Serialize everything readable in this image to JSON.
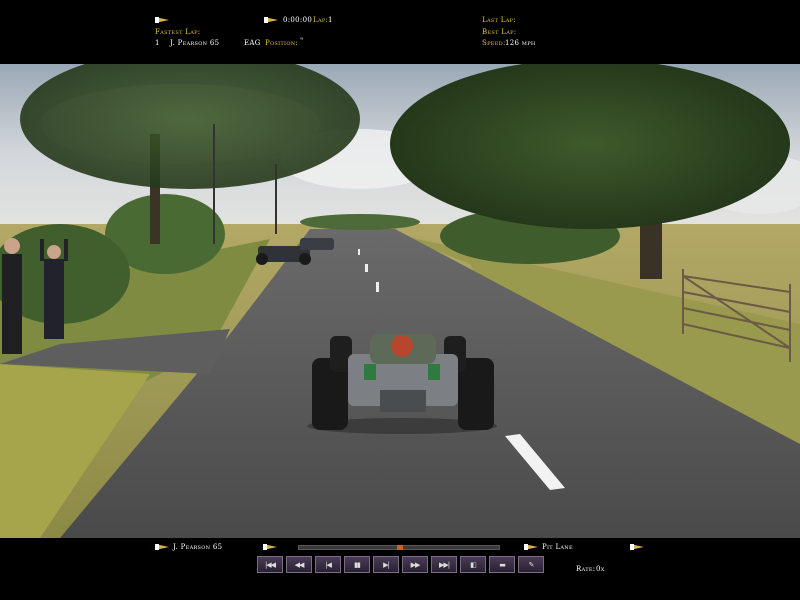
{
  "hud_top": {
    "fastest_lap_label": "Fastest Lap:",
    "fastest_lap_pos": "1",
    "fastest_lap_driver": "J. Pearson 65",
    "team": "EAG",
    "position_label": "Position:",
    "position_value": "\"",
    "race_time": "0:00:00",
    "lap_label": "Lap:",
    "lap_value": "1",
    "last_lap_label": "Last Lap:",
    "best_lap_label": "Best Lap:",
    "speed_label": "Speed:",
    "speed_value": "126 mph"
  },
  "hud_bottom": {
    "driver": "J. Pearson 65",
    "location": "Pit Lane",
    "rate_label": "Rate:",
    "rate_value": "0x",
    "playback_progress": 0.5,
    "controls": [
      {
        "name": "skip-start-button",
        "glyph": "|◀◀"
      },
      {
        "name": "rewind-button",
        "glyph": "◀◀"
      },
      {
        "name": "step-back-button",
        "glyph": "|◀"
      },
      {
        "name": "pause-button",
        "glyph": "▮▮"
      },
      {
        "name": "play-button",
        "glyph": "▶|"
      },
      {
        "name": "fast-forward-button",
        "glyph": "▶▶"
      },
      {
        "name": "skip-end-button",
        "glyph": "▶▶|"
      },
      {
        "name": "camera-button",
        "glyph": "◧"
      },
      {
        "name": "view-button",
        "glyph": "▬"
      },
      {
        "name": "options-button",
        "glyph": "✎"
      }
    ]
  },
  "colors": {
    "label": "#e8c43a",
    "value": "#ffffff",
    "panel": "#000000"
  }
}
